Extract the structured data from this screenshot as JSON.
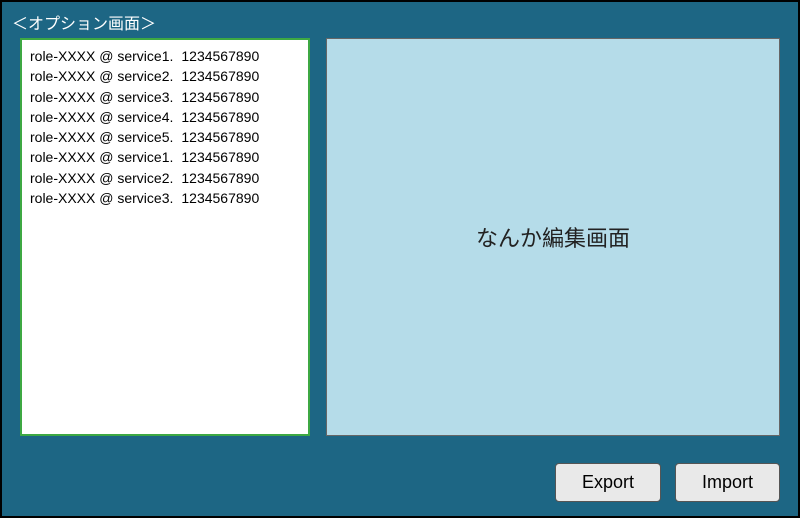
{
  "title": "＜オプション画面＞",
  "list": [
    {
      "role": "role-XXXX @ service1.",
      "id": "1234567890"
    },
    {
      "role": "role-XXXX @ service2.",
      "id": "1234567890"
    },
    {
      "role": "role-XXXX @ service3.",
      "id": "1234567890"
    },
    {
      "role": "role-XXXX @ service4.",
      "id": "1234567890"
    },
    {
      "role": "role-XXXX @ service5.",
      "id": "1234567890"
    },
    {
      "role": "role-XXXX @ service1.",
      "id": "1234567890"
    },
    {
      "role": "role-XXXX @ service2.",
      "id": "1234567890"
    },
    {
      "role": "role-XXXX @ service3.",
      "id": "1234567890"
    }
  ],
  "edit_label": "なんか編集画面",
  "buttons": {
    "export": "Export",
    "import": "Import"
  }
}
